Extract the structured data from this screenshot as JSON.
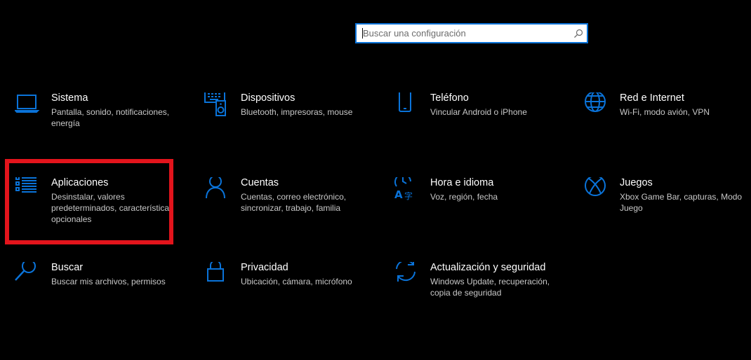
{
  "search": {
    "placeholder": "Buscar una configuración",
    "value": ""
  },
  "colors": {
    "accent": "#0a73d9",
    "highlight": "#e3141c",
    "background": "#000000"
  },
  "tiles": [
    {
      "icon": "laptop-icon",
      "title": "Sistema",
      "desc": "Pantalla, sonido, notificaciones, energía"
    },
    {
      "icon": "keyboard-speaker-icon",
      "title": "Dispositivos",
      "desc": "Bluetooth, impresoras, mouse"
    },
    {
      "icon": "phone-icon",
      "title": "Teléfono",
      "desc": "Vincular Android o iPhone"
    },
    {
      "icon": "globe-icon",
      "title": "Red e Internet",
      "desc": "Wi-Fi, modo avión, VPN"
    },
    {
      "icon": "app-list-icon",
      "title": "Aplicaciones",
      "desc": "Desinstalar, valores predeterminados, características opcionales"
    },
    {
      "icon": "person-icon",
      "title": "Cuentas",
      "desc": "Cuentas, correo electrónico, sincronizar, trabajo, familia"
    },
    {
      "icon": "time-language-icon",
      "title": "Hora e idioma",
      "desc": "Voz, región, fecha"
    },
    {
      "icon": "xbox-icon",
      "title": "Juegos",
      "desc": "Xbox Game Bar, capturas, Modo Juego"
    },
    {
      "icon": "search-icon",
      "title": "Buscar",
      "desc": "Buscar mis archivos, permisos"
    },
    {
      "icon": "lock-icon",
      "title": "Privacidad",
      "desc": "Ubicación, cámara, micrófono"
    },
    {
      "icon": "sync-icon",
      "title": "Actualización y seguridad",
      "desc": "Windows Update, recuperación, copia de seguridad"
    }
  ]
}
